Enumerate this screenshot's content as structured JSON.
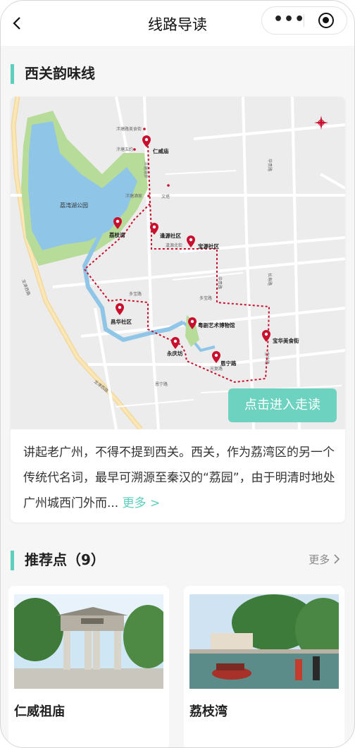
{
  "navbar": {
    "title": "线路导读",
    "back_icon": "chevron-left-icon",
    "more_icon": "more-dots-icon",
    "close_icon": "target-icon"
  },
  "route": {
    "title": "西关韵味线",
    "enter_button": "点击进入走读",
    "description": "讲起老广州，不得不提到西关。西关，作为荔湾区的另一个传统代名词，最早可溯源至秦汉的“荔园”，由于明清时地处广州城西门外而...",
    "more_label": "更多 >"
  },
  "map": {
    "park_label": "荔湾湖公园",
    "road_labels": [
      "多宝路",
      "多宝路",
      "长寿路",
      "宝华路",
      "华贵路",
      "龙津西路",
      "恩宁路",
      "光复路",
      "逢源北街",
      "泮塘五约",
      "泮塘路美食街",
      "泮塘滑步",
      "泮塘酒家",
      "文塔"
    ],
    "markers": [
      "仁威庙",
      "荔枝湾",
      "逢源社区",
      "宝源社区",
      "昌华社区",
      "粤剧艺术博物馆",
      "永庆坊",
      "恩宁路",
      "宝华美食街"
    ]
  },
  "recommend": {
    "title": "推荐点（9）",
    "more_label": "更多",
    "items": [
      {
        "name": "仁威祖庙"
      },
      {
        "name": "荔枝湾"
      }
    ]
  },
  "colors": {
    "accent": "#5fcfbd",
    "button": "#6dd3c0",
    "route": "#c8102e"
  }
}
